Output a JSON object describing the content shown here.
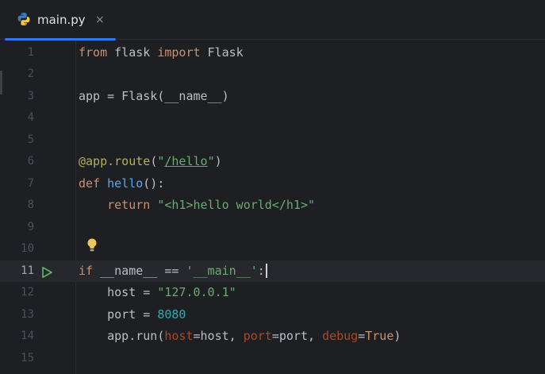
{
  "tab": {
    "filename": "main.py",
    "close_glyph": "×",
    "icon": "python-icon"
  },
  "editor": {
    "current_line": 11,
    "lines": [
      {
        "number": "1",
        "tokens": [
          {
            "t": "from",
            "c": "kw"
          },
          {
            "t": " flask ",
            "c": ""
          },
          {
            "t": "import",
            "c": "kw"
          },
          {
            "t": " Flask",
            "c": ""
          }
        ]
      },
      {
        "number": "2",
        "tokens": []
      },
      {
        "number": "3",
        "tokens": [
          {
            "t": "app = Flask(__name__)",
            "c": ""
          }
        ]
      },
      {
        "number": "4",
        "tokens": []
      },
      {
        "number": "5",
        "tokens": []
      },
      {
        "number": "6",
        "tokens": [
          {
            "t": "@app.route",
            "c": "deco"
          },
          {
            "t": "(",
            "c": ""
          },
          {
            "t": "\"",
            "c": "str"
          },
          {
            "t": "/hello",
            "c": "str link"
          },
          {
            "t": "\"",
            "c": "str"
          },
          {
            "t": ")",
            "c": ""
          }
        ]
      },
      {
        "number": "7",
        "tokens": [
          {
            "t": "def",
            "c": "kw"
          },
          {
            "t": " ",
            "c": ""
          },
          {
            "t": "hello",
            "c": "fn"
          },
          {
            "t": "():",
            "c": ""
          }
        ]
      },
      {
        "number": "8",
        "tokens": [
          {
            "t": "    ",
            "c": ""
          },
          {
            "t": "return",
            "c": "kw"
          },
          {
            "t": " ",
            "c": ""
          },
          {
            "t": "\"<h1>hello world</h1>\"",
            "c": "str"
          }
        ]
      },
      {
        "number": "9",
        "tokens": []
      },
      {
        "number": "10",
        "tokens": []
      },
      {
        "number": "11",
        "tokens": [
          {
            "t": "if",
            "c": "kw"
          },
          {
            "t": " __name__ == ",
            "c": ""
          },
          {
            "t": "'__main__'",
            "c": "str"
          },
          {
            "t": ":",
            "c": ""
          }
        ]
      },
      {
        "number": "12",
        "tokens": [
          {
            "t": "    host = ",
            "c": ""
          },
          {
            "t": "\"127.0.0.1\"",
            "c": "str"
          }
        ]
      },
      {
        "number": "13",
        "tokens": [
          {
            "t": "    port = ",
            "c": ""
          },
          {
            "t": "8080",
            "c": "num"
          }
        ]
      },
      {
        "number": "14",
        "tokens": [
          {
            "t": "    app.run(",
            "c": ""
          },
          {
            "t": "host",
            "c": "param"
          },
          {
            "t": "=host, ",
            "c": ""
          },
          {
            "t": "port",
            "c": "param"
          },
          {
            "t": "=port, ",
            "c": ""
          },
          {
            "t": "debug",
            "c": "param"
          },
          {
            "t": "=",
            "c": ""
          },
          {
            "t": "True",
            "c": "kw"
          },
          {
            "t": ")",
            "c": ""
          }
        ]
      },
      {
        "number": "15",
        "tokens": []
      }
    ]
  },
  "icons": {
    "run": "run-icon",
    "intention": "lightbulb-icon"
  },
  "colors": {
    "background": "#1e1f22",
    "tab_accent": "#3574f0",
    "keyword": "#cf8e6d",
    "string": "#6aab73",
    "number": "#2aacb8",
    "function": "#56a8f5",
    "decorator": "#b3ae60",
    "named_param": "#aa4926",
    "run_icon": "#5fb865",
    "bulb": "#f2c55c"
  }
}
